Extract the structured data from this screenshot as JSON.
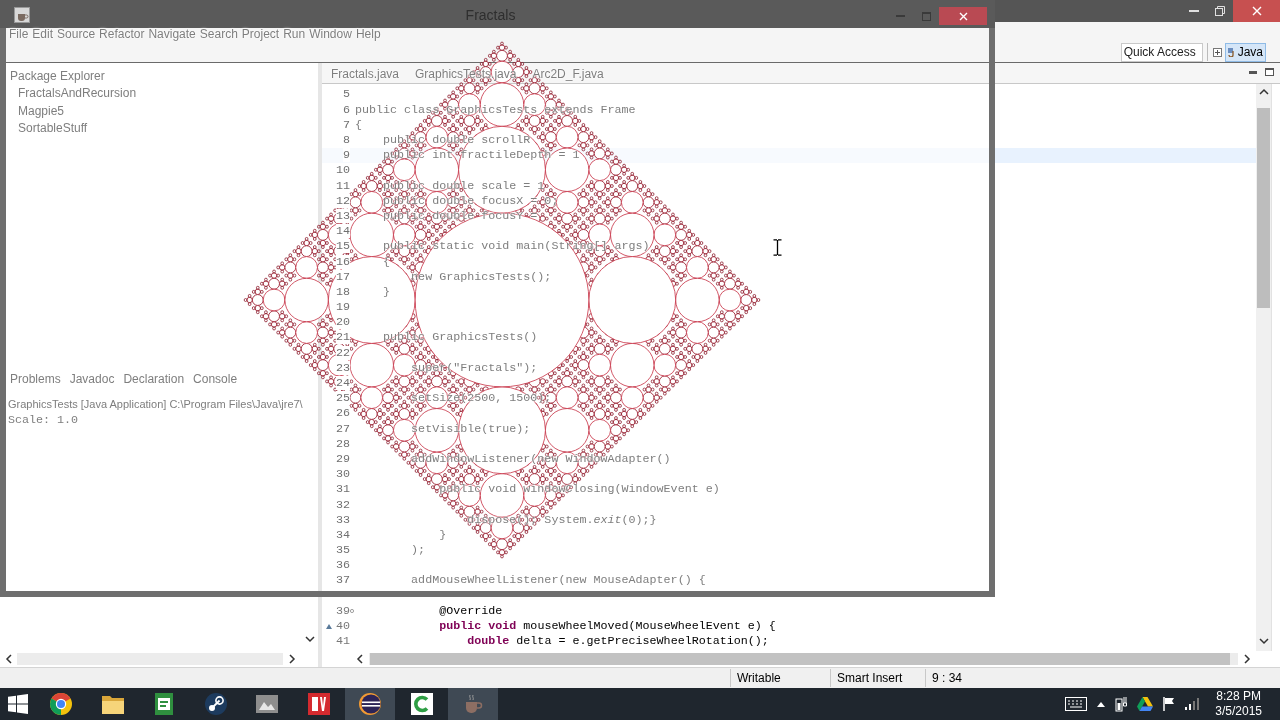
{
  "fractals_window": {
    "title": "Fractals"
  },
  "eclipse": {
    "menu": [
      "File",
      "Edit",
      "Source",
      "Refactor",
      "Navigate",
      "Search",
      "Project",
      "Run",
      "Window",
      "Help"
    ],
    "quick_access": {
      "placeholder": "Quick Access"
    },
    "perspectives": [
      {
        "label": "Java",
        "selected": true
      }
    ],
    "package_explorer": {
      "title": "Package Explorer",
      "projects": [
        "FractalsAndRecursion",
        "Magpie5",
        "SortableStuff"
      ]
    },
    "console": {
      "tabs": [
        "Problems",
        "Javadoc",
        "Declaration",
        "Console"
      ],
      "description": "GraphicsTests [Java Application] C:\\Program Files\\Java\\jre7\\",
      "output": [
        "Scale: 1.0"
      ]
    },
    "editor": {
      "tabs": [
        "Fractals.java",
        "GraphicsTests.java",
        "Arc2D_F.java"
      ],
      "lines": [
        {
          "kind": "line",
          "number": "5",
          "current": false
        },
        {
          "kind": "line",
          "number": "6",
          "text": "public class GraphicsTests extends Frame",
          "current": false
        },
        {
          "kind": "line",
          "number": "7",
          "text": "{",
          "current": false
        },
        {
          "kind": "line",
          "number": "8",
          "text": "    public double scrollR",
          "current": false
        },
        {
          "kind": "line",
          "number": "9",
          "text": "    public int fractileDepth = 1",
          "current": true
        },
        {
          "kind": "line",
          "number": "10",
          "current": false
        },
        {
          "kind": "line",
          "number": "11",
          "text": "    public double scale = 1",
          "current": false
        },
        {
          "kind": "line",
          "number": "12",
          "text": "    public double focusX = 0;",
          "current": false
        },
        {
          "kind": "line",
          "number": "13",
          "text": "    public double focusY =",
          "current": false
        },
        {
          "kind": "line",
          "number": "14",
          "current": false
        },
        {
          "kind": "line",
          "number": "15",
          "text": "    public static void main(String[] args)",
          "current": false
        },
        {
          "kind": "line",
          "number": "16",
          "text": "    {",
          "current": false
        },
        {
          "kind": "line",
          "number": "17",
          "text": "        new GraphicsTests();",
          "current": false
        },
        {
          "kind": "line",
          "number": "18",
          "text": "    }",
          "current": false
        },
        {
          "kind": "line",
          "number": "19",
          "current": false
        },
        {
          "kind": "line",
          "number": "20",
          "current": false
        },
        {
          "kind": "line",
          "number": "21",
          "text": "    public GraphicsTests()",
          "current": false
        },
        {
          "kind": "line",
          "number": "22",
          "current": false
        },
        {
          "kind": "line",
          "number": "23",
          "text": "        super(\"Fractals\");",
          "current": false
        },
        {
          "kind": "line",
          "number": "24",
          "current": false
        },
        {
          "kind": "line",
          "number": "25",
          "text": "        setSize(2500, 1500);",
          "current": false
        },
        {
          "kind": "line",
          "number": "26",
          "current": false
        },
        {
          "kind": "line",
          "number": "27",
          "text": "        setVisible(true);",
          "current": false
        },
        {
          "kind": "line",
          "number": "28",
          "current": false
        },
        {
          "kind": "line",
          "number": "29",
          "text": "        addWindowListener(new WindowAdapter()",
          "current": false
        },
        {
          "kind": "line",
          "number": "30",
          "current": false
        },
        {
          "kind": "line",
          "number": "31",
          "text": "            public void windowClosing(WindowEvent e)",
          "current": false
        },
        {
          "kind": "line",
          "number": "32",
          "current": false
        },
        {
          "kind": "line",
          "number": "33",
          "text": "                dispose(); System.*exit*(0);}",
          "current": false
        },
        {
          "kind": "line",
          "number": "34",
          "text": "            }",
          "current": false
        },
        {
          "kind": "line",
          "number": "35",
          "text": "        );",
          "current": false
        },
        {
          "kind": "line",
          "number": "36",
          "current": false
        },
        {
          "kind": "line",
          "number": "37",
          "text": "        addMouseWheelListener(new MouseAdapter() {",
          "current": false
        },
        {
          "kind": "line",
          "current": false
        },
        {
          "kind": "fold",
          "number": "39",
          "text": "            @Override",
          "current": false
        },
        {
          "kind": "override",
          "number": "40",
          "text": "            **public** **void** mouseWheelMoved(MouseWheelEvent e) {",
          "current": false
        },
        {
          "kind": "line",
          "number": "41",
          "text": "                **double** delta = e.getPreciseWheelRotation();",
          "current": false
        }
      ]
    },
    "status_bar": [
      "Writable",
      "Smart Insert",
      "9 : 34"
    ]
  },
  "taskbar": {
    "apps": [
      {
        "kind": "browser",
        "active": false
      },
      {
        "kind": "folder",
        "active": false
      },
      {
        "kind": "document",
        "active": false
      },
      {
        "kind": "game",
        "active": false
      },
      {
        "kind": "tool",
        "active": false
      },
      {
        "kind": "cad",
        "active": false
      },
      {
        "kind": "ide",
        "active": true
      },
      {
        "kind": "recorder",
        "active": false
      },
      {
        "kind": "java",
        "active": true
      }
    ],
    "clock": {
      "time": "8:28 PM",
      "date": "3/5/2015"
    }
  }
}
